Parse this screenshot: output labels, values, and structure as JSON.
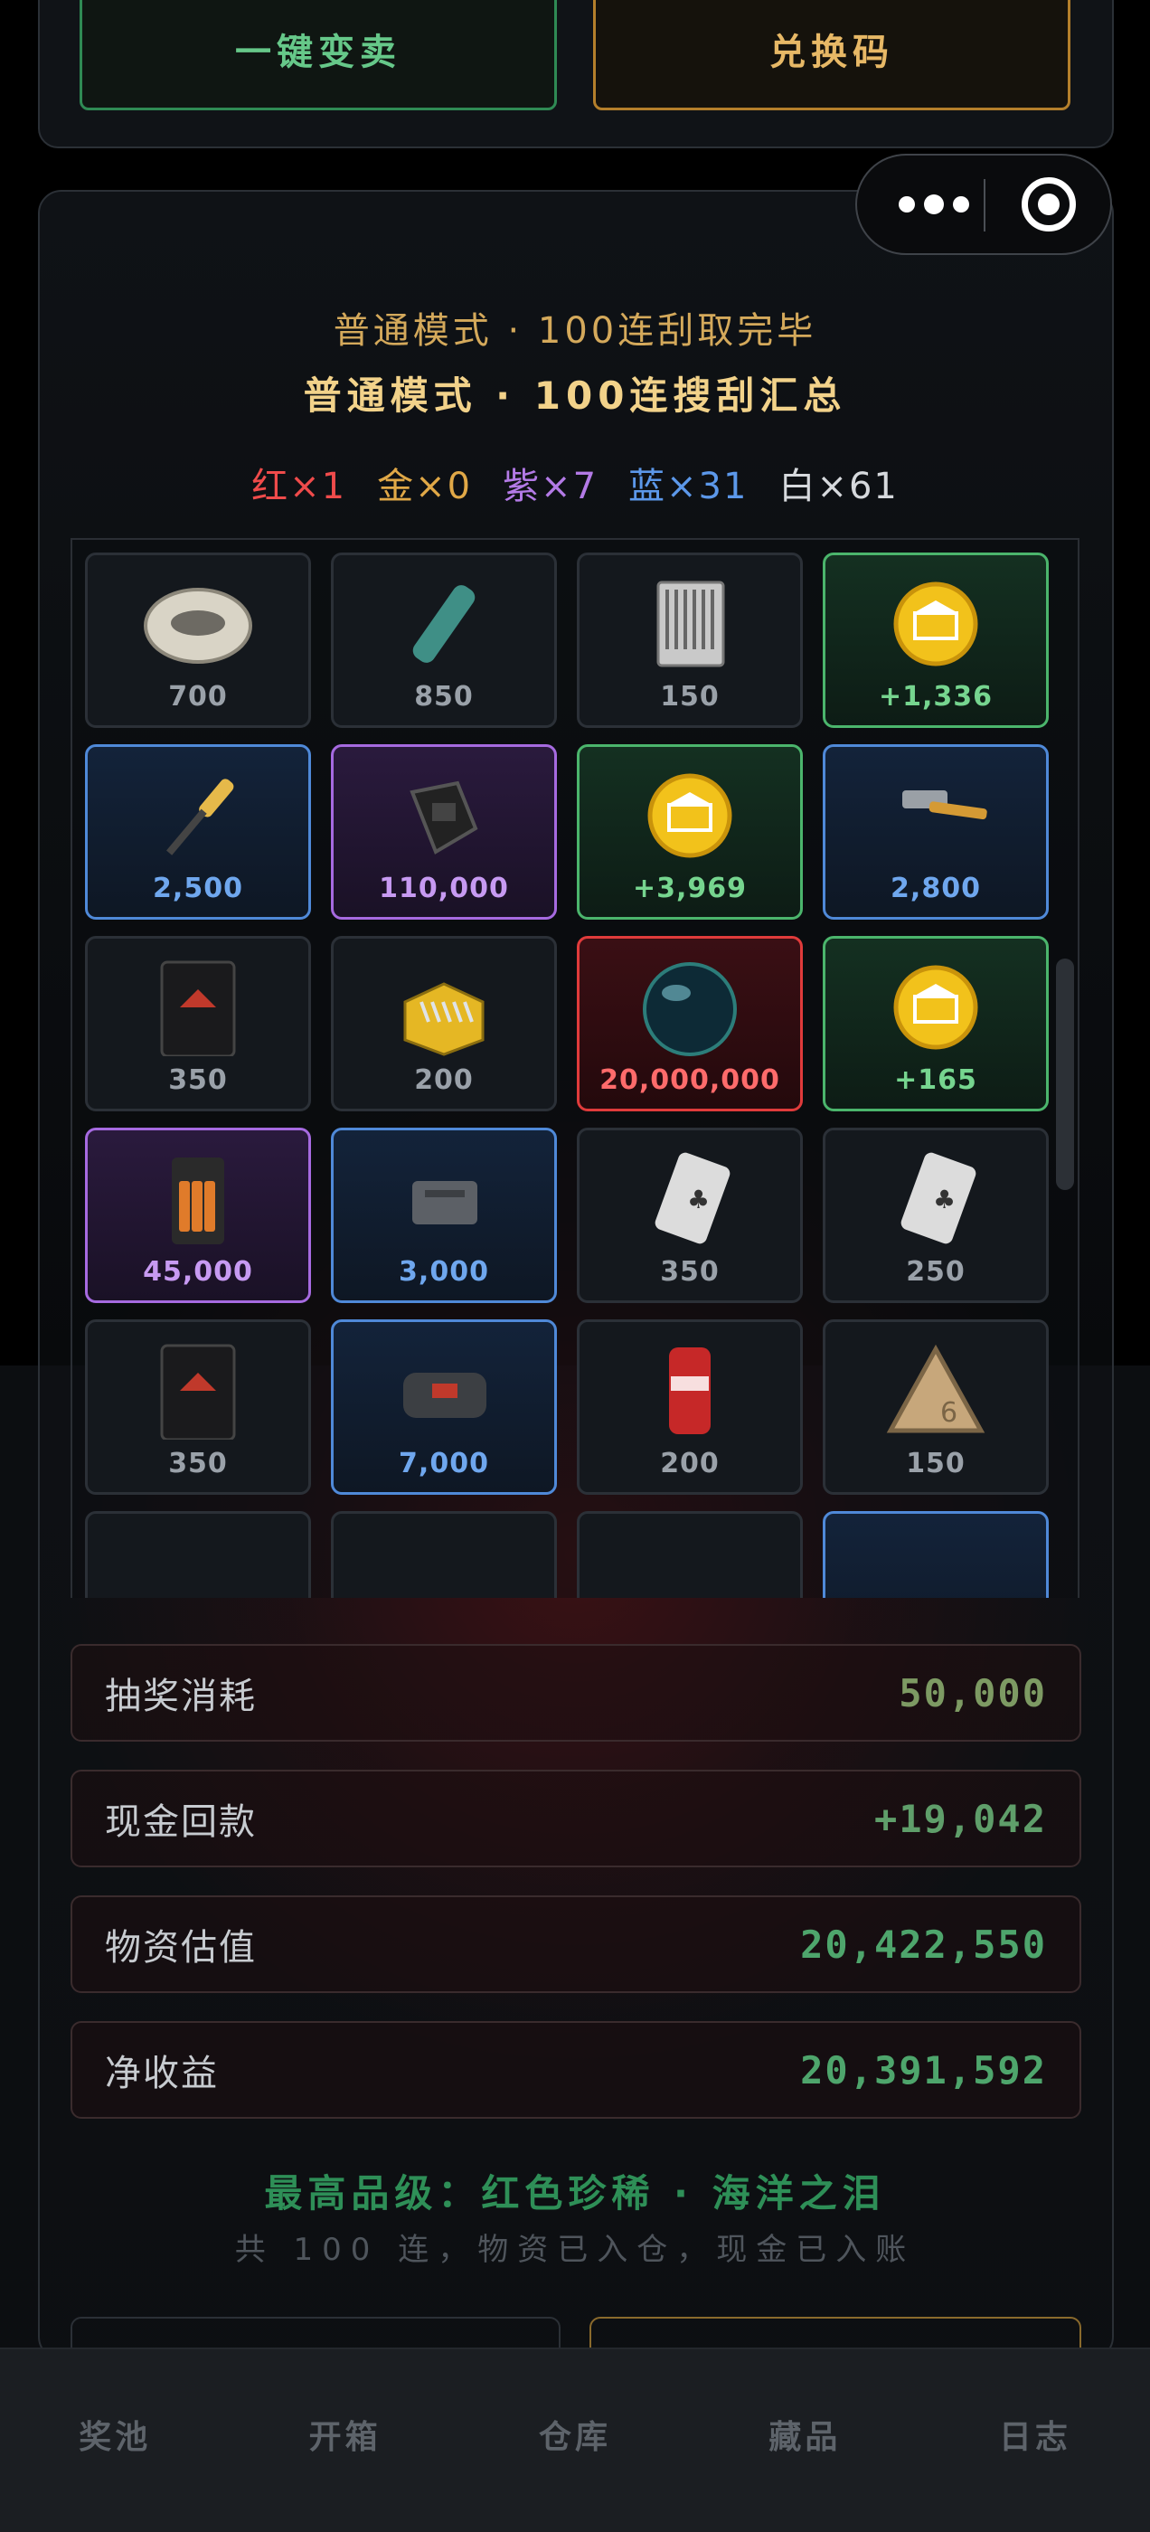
{
  "top_actions": {
    "sell_all": "一键变卖",
    "redeem_code": "兑换码"
  },
  "result": {
    "subtitle": "普通模式 · 100连刮取完毕",
    "title": "普通模式 · 100连搜刮汇总",
    "counts": [
      {
        "label": "红×1",
        "color": "#ef4b4b"
      },
      {
        "label": "金×0",
        "color": "#e0a847"
      },
      {
        "label": "紫×7",
        "color": "#b37ae6"
      },
      {
        "label": "蓝×31",
        "color": "#5c98ea"
      },
      {
        "label": "白×61",
        "color": "#d6d9dd"
      }
    ]
  },
  "items": [
    {
      "value": "700",
      "rarity": "white",
      "icon": "silver-brooch-icon"
    },
    {
      "value": "850",
      "rarity": "white",
      "icon": "green-tube-icon"
    },
    {
      "value": "150",
      "rarity": "white",
      "icon": "matchbook-icon"
    },
    {
      "value": "+1,336",
      "rarity": "green",
      "icon": "gold-coin-icon"
    },
    {
      "value": "2,500",
      "rarity": "blue",
      "icon": "screwdriver-icon"
    },
    {
      "value": "110,000",
      "rarity": "purple",
      "icon": "black-device-icon"
    },
    {
      "value": "+3,969",
      "rarity": "green",
      "icon": "gold-coin-icon"
    },
    {
      "value": "2,800",
      "rarity": "blue",
      "icon": "hammer-icon"
    },
    {
      "value": "350",
      "rarity": "white",
      "icon": "coffee-bag-icon"
    },
    {
      "value": "200",
      "rarity": "white",
      "icon": "nail-box-icon"
    },
    {
      "value": "20,000,000",
      "rarity": "red",
      "icon": "ocean-tear-orb-icon"
    },
    {
      "value": "+165",
      "rarity": "green",
      "icon": "gold-coin-icon"
    },
    {
      "value": "45,000",
      "rarity": "purple",
      "icon": "battery-pack-icon"
    },
    {
      "value": "3,000",
      "rarity": "blue",
      "icon": "ammo-box-icon"
    },
    {
      "value": "350",
      "rarity": "white",
      "icon": "playing-card-icon"
    },
    {
      "value": "250",
      "rarity": "white",
      "icon": "playing-card-icon"
    },
    {
      "value": "350",
      "rarity": "white",
      "icon": "coffee-bag-icon"
    },
    {
      "value": "7,000",
      "rarity": "blue",
      "icon": "duffel-bag-icon"
    },
    {
      "value": "200",
      "rarity": "white",
      "icon": "soda-can-icon"
    },
    {
      "value": "150",
      "rarity": "white",
      "icon": "triangle-badge-icon"
    }
  ],
  "summary": [
    {
      "label": "抽奖消耗",
      "value": "50,000",
      "color": "#7d9a63"
    },
    {
      "label": "现金回款",
      "value": "+19,042",
      "color": "#5f9e6a"
    },
    {
      "label": "物资估值",
      "value": "20,422,550",
      "color": "#4ea56c"
    },
    {
      "label": "净收益",
      "value": "20,391,592",
      "color": "#4ea56c"
    }
  ],
  "best": "最高品级：红色珍稀 · 海洋之泪",
  "note": "共 100 连，物资已入仓，现金已入账",
  "nav": [
    "奖池",
    "开箱",
    "仓库",
    "藏品",
    "日志"
  ]
}
